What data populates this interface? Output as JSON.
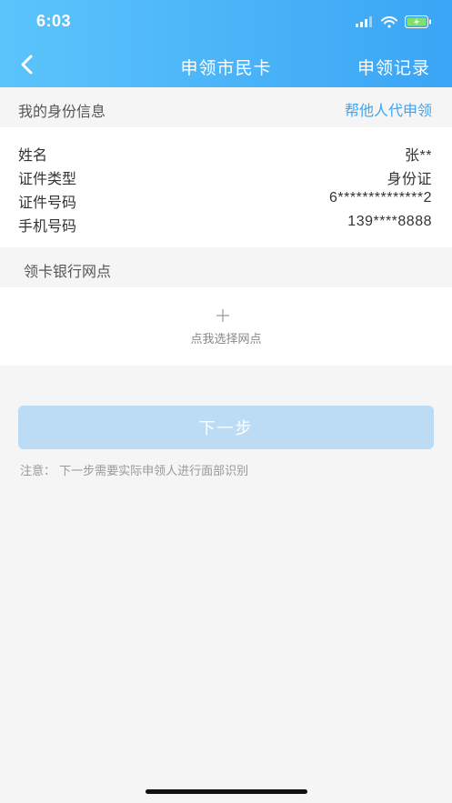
{
  "status": {
    "time": "6:03"
  },
  "nav": {
    "title": "申领市民卡",
    "right_label": "申领记录"
  },
  "identity": {
    "section_title": "我的身份信息",
    "help_link": "帮他人代申领",
    "rows": [
      {
        "label": "姓名",
        "value": "张**"
      },
      {
        "label": "证件类型",
        "value": "身份证"
      },
      {
        "label": "证件号码",
        "value": "6**************2"
      },
      {
        "label": "手机号码",
        "value": "139****8888"
      }
    ]
  },
  "branch": {
    "section_title": "领卡银行网点",
    "select_text": "点我选择网点"
  },
  "actions": {
    "next_label": "下一步",
    "note": "注意： 下一步需要实际申领人进行面部识别"
  },
  "colors": {
    "accent": "#3aa5f5",
    "header_start": "#5cc4fb",
    "button_disabled": "#bcdcf6"
  }
}
